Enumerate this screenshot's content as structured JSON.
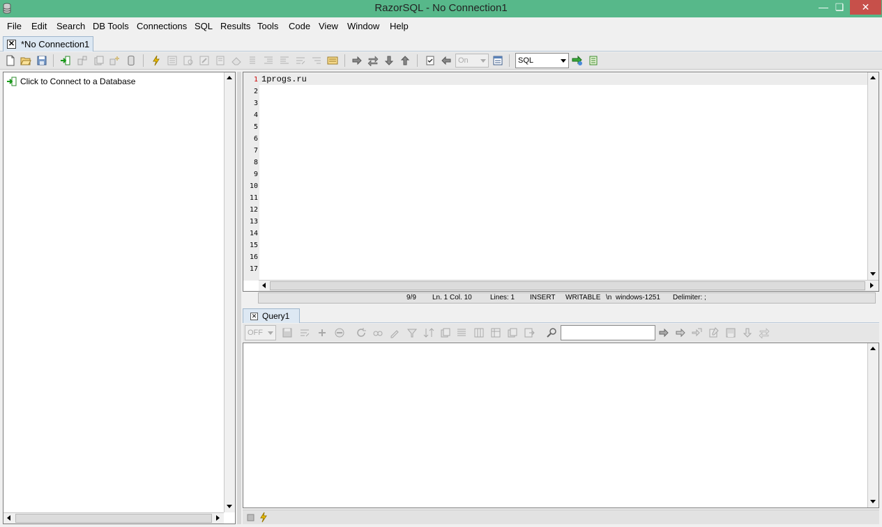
{
  "window": {
    "title": "RazorSQL - No Connection1",
    "minimize": "—",
    "restore": "❏",
    "close": "✕"
  },
  "menu": [
    "File",
    "Edit",
    "Search",
    "DB Tools",
    "Connections",
    "SQL",
    "Results",
    "Tools",
    "Code",
    "View",
    "Window",
    "Help"
  ],
  "connection_tab": {
    "label": "*No Connection1"
  },
  "toolbar": {
    "auto_commit_value": "On",
    "language_value": "SQL"
  },
  "tree": {
    "connect_item": "Click to Connect to a Database"
  },
  "editor": {
    "line_numbers": [
      "1",
      "2",
      "3",
      "4",
      "5",
      "6",
      "7",
      "8",
      "9",
      "10",
      "11",
      "12",
      "13",
      "14",
      "15",
      "16",
      "17"
    ],
    "code": "1progs.ru"
  },
  "status": {
    "position": "9/9",
    "cursor": "Ln. 1 Col. 10",
    "lines": "Lines: 1",
    "mode": "INSERT",
    "writable": "WRITABLE",
    "newline": "\\n",
    "encoding": "windows-1251",
    "delimiter": "Delimiter: ;"
  },
  "results": {
    "tab_label": "Query1",
    "mode_value": "OFF",
    "search_value": ""
  },
  "colors": {
    "titlebar": "#57b88a",
    "close_button": "#c7504a",
    "tab_active": "#dde8f3",
    "current_line_number": "#cc0000"
  }
}
